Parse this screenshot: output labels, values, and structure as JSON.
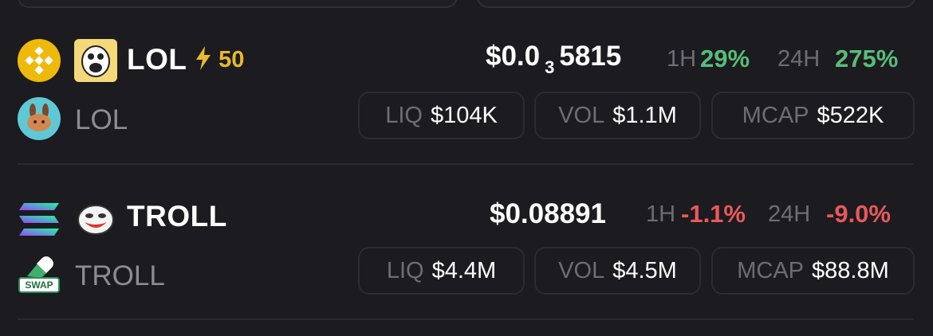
{
  "tokens": [
    {
      "symbol": "LOL",
      "boost_icon": "lightning-icon",
      "boost": "50",
      "name": "LOL",
      "chain_icon": "bnb-chain-icon",
      "dex_icon": "pancakeswap-icon",
      "token_icon": "trollface-meme-icon",
      "price_prefix": "$0.0",
      "price_zeros": "3",
      "price_digits": "5815",
      "h1_label": "1H",
      "h1_change": "29%",
      "h24_label": "24H",
      "h24_change": "275%",
      "liq_label": "LIQ",
      "liq": "$104K",
      "vol_label": "VOL",
      "vol": "$1.1M",
      "mcap_label": "MCAP",
      "mcap": "$522K"
    },
    {
      "symbol": "TROLL",
      "name": "TROLL",
      "chain_icon": "solana-icon",
      "dex_icon": "swap-icon",
      "dex_badge": "SWAP",
      "token_icon": "trollface-icon",
      "price": "$0.08891",
      "h1_label": "1H",
      "h1_change": "-1.1%",
      "h24_label": "24H",
      "h24_change": "-9.0%",
      "liq_label": "LIQ",
      "liq": "$4.4M",
      "vol_label": "VOL",
      "vol": "$4.5M",
      "mcap_label": "MCAP",
      "mcap": "$88.8M"
    }
  ],
  "colors": {
    "background": "#1c1b1f",
    "positive": "#56be7a",
    "negative": "#e8595c",
    "boost": "#e8b92f",
    "muted": "#8d8c92"
  }
}
